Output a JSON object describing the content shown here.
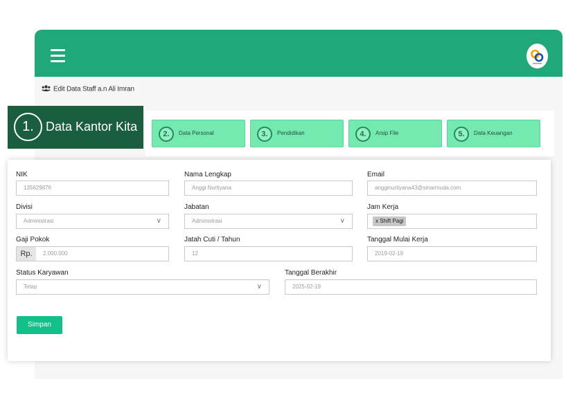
{
  "header": {
    "menu_icon": "hamburger-icon",
    "logo_icon": "company-logo"
  },
  "breadcrumb": {
    "icon": "users-icon",
    "title": "Edit Data Staff a.n Ali Imran"
  },
  "callout": {
    "number": "1.",
    "label": "Data Kantor Kita"
  },
  "steps": [
    {
      "number": "2.",
      "label": "Data Personal"
    },
    {
      "number": "3.",
      "label": "Pendidikan"
    },
    {
      "number": "4.",
      "label": "Arsip File"
    },
    {
      "number": "5.",
      "label": "Data Keuangan"
    }
  ],
  "form": {
    "nik": {
      "label": "NIK",
      "value": "135629876"
    },
    "nama": {
      "label": "Nama Lengkap",
      "value": "Anggi Nurtiyana"
    },
    "email": {
      "label": "Email",
      "value": "angginurtiyana43@sinarmuda.com"
    },
    "divisi": {
      "label": "Divisi",
      "value": "Administrasi"
    },
    "jabatan": {
      "label": "Jabatan",
      "value": "Administrasi"
    },
    "jam_kerja": {
      "label": "Jam Kerja",
      "tag": "x Shift Pagi"
    },
    "gaji": {
      "label": "Gaji Pokok",
      "prefix": "Rp.",
      "value": "2.000.000"
    },
    "cuti": {
      "label": "Jatah Cuti / Tahun",
      "value": "12"
    },
    "mulai": {
      "label": "Tanggal Mulai Kerja",
      "value": "2019-02-19"
    },
    "status": {
      "label": "Status Karyawan",
      "value": "Tetap"
    },
    "berakhir": {
      "label": "Tanggal Berakhir",
      "value": "2025-02-19"
    },
    "save_label": "Simpan"
  },
  "colors": {
    "brand": "#21a87a",
    "step_bg": "#74e9b0",
    "callout_bg": "#1b5e3f",
    "save_btn": "#13c08a"
  }
}
